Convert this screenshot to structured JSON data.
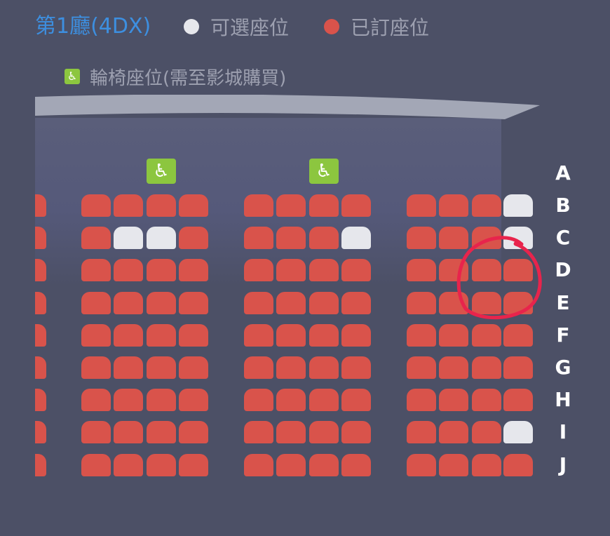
{
  "header": {
    "hall_title": "第1廳(4DX)",
    "legend": [
      {
        "label": "可選座位",
        "color": "#e6e7ec"
      },
      {
        "label": "已訂座位",
        "color": "#d9534b"
      }
    ],
    "wheelchair_legend": "輪椅座位(需至影城購買)"
  },
  "icons": {
    "wheelchair": "wheelchair-icon",
    "annotation": "red-hand-drawn-circle"
  },
  "colors": {
    "booked": "#d9534b",
    "available": "#e6e7ec",
    "wheelchair": "#8cc63f",
    "title": "#3d8fe0",
    "background": "#4c5066",
    "annotation": "#e8244c"
  },
  "seat_map": {
    "rows": [
      {
        "label": "A",
        "seats": ""
      },
      {
        "label": "B",
        "seats": "xxxxxxxxxxxxo"
      },
      {
        "label": "C",
        "seats": "xooxxxxoxxxo"
      },
      {
        "label": "D",
        "seats": "xxxxxxxxxxxx"
      },
      {
        "label": "E",
        "seats": "xxxxxxxxxxxx"
      },
      {
        "label": "F",
        "seats": "xxxxxxxxxxxx"
      },
      {
        "label": "G",
        "seats": "xxxxxxxxxxxx"
      },
      {
        "label": "H",
        "seats": "xxxxxxxxxxxx"
      },
      {
        "label": "I",
        "seats": "xxxxxxxxxxxo"
      },
      {
        "label": "J",
        "seats": "xxxxxxxxxxxx"
      }
    ],
    "wheelchair_markers": [
      {
        "row": "A",
        "block": 1,
        "seat": 3
      },
      {
        "row": "A",
        "block": 2,
        "seat": 3
      }
    ],
    "circled_seats": [
      "C12",
      "D11",
      "D12",
      "E11",
      "E12"
    ]
  }
}
